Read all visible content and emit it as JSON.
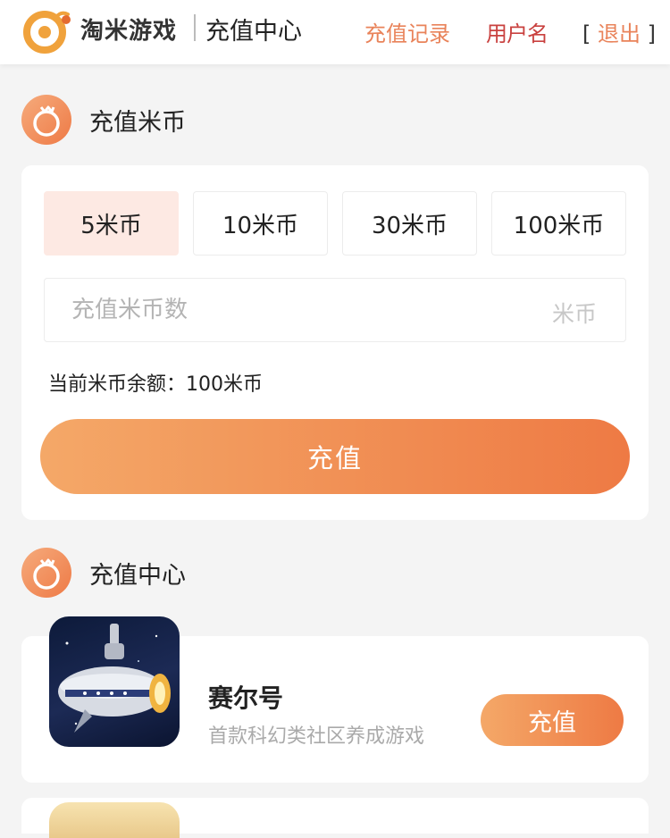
{
  "header": {
    "brand": "淘米游戏",
    "title": "充值中心",
    "history_link": "充值记录",
    "user_name": "用户名",
    "logout_open": "[",
    "logout_label": "退出",
    "logout_close": "]"
  },
  "recharge_section": {
    "title": "充值米币",
    "amounts": [
      {
        "label": "5米币",
        "selected": true
      },
      {
        "label": "10米币",
        "selected": false
      },
      {
        "label": "30米币",
        "selected": false
      },
      {
        "label": "100米币",
        "selected": false
      }
    ],
    "input_placeholder": "充值米币数",
    "input_unit": "米币",
    "balance_text": "当前米币余额：100米币",
    "submit_label": "充值"
  },
  "center_section": {
    "title": "充值中心",
    "games": [
      {
        "name": "赛尔号",
        "description": "首款科幻类社区养成游戏",
        "button_label": "充值"
      }
    ]
  },
  "colors": {
    "accent": "#ee7a44",
    "accent_light": "#f4a868",
    "selected_bg": "#fde9e3",
    "link": "#e9835a"
  }
}
